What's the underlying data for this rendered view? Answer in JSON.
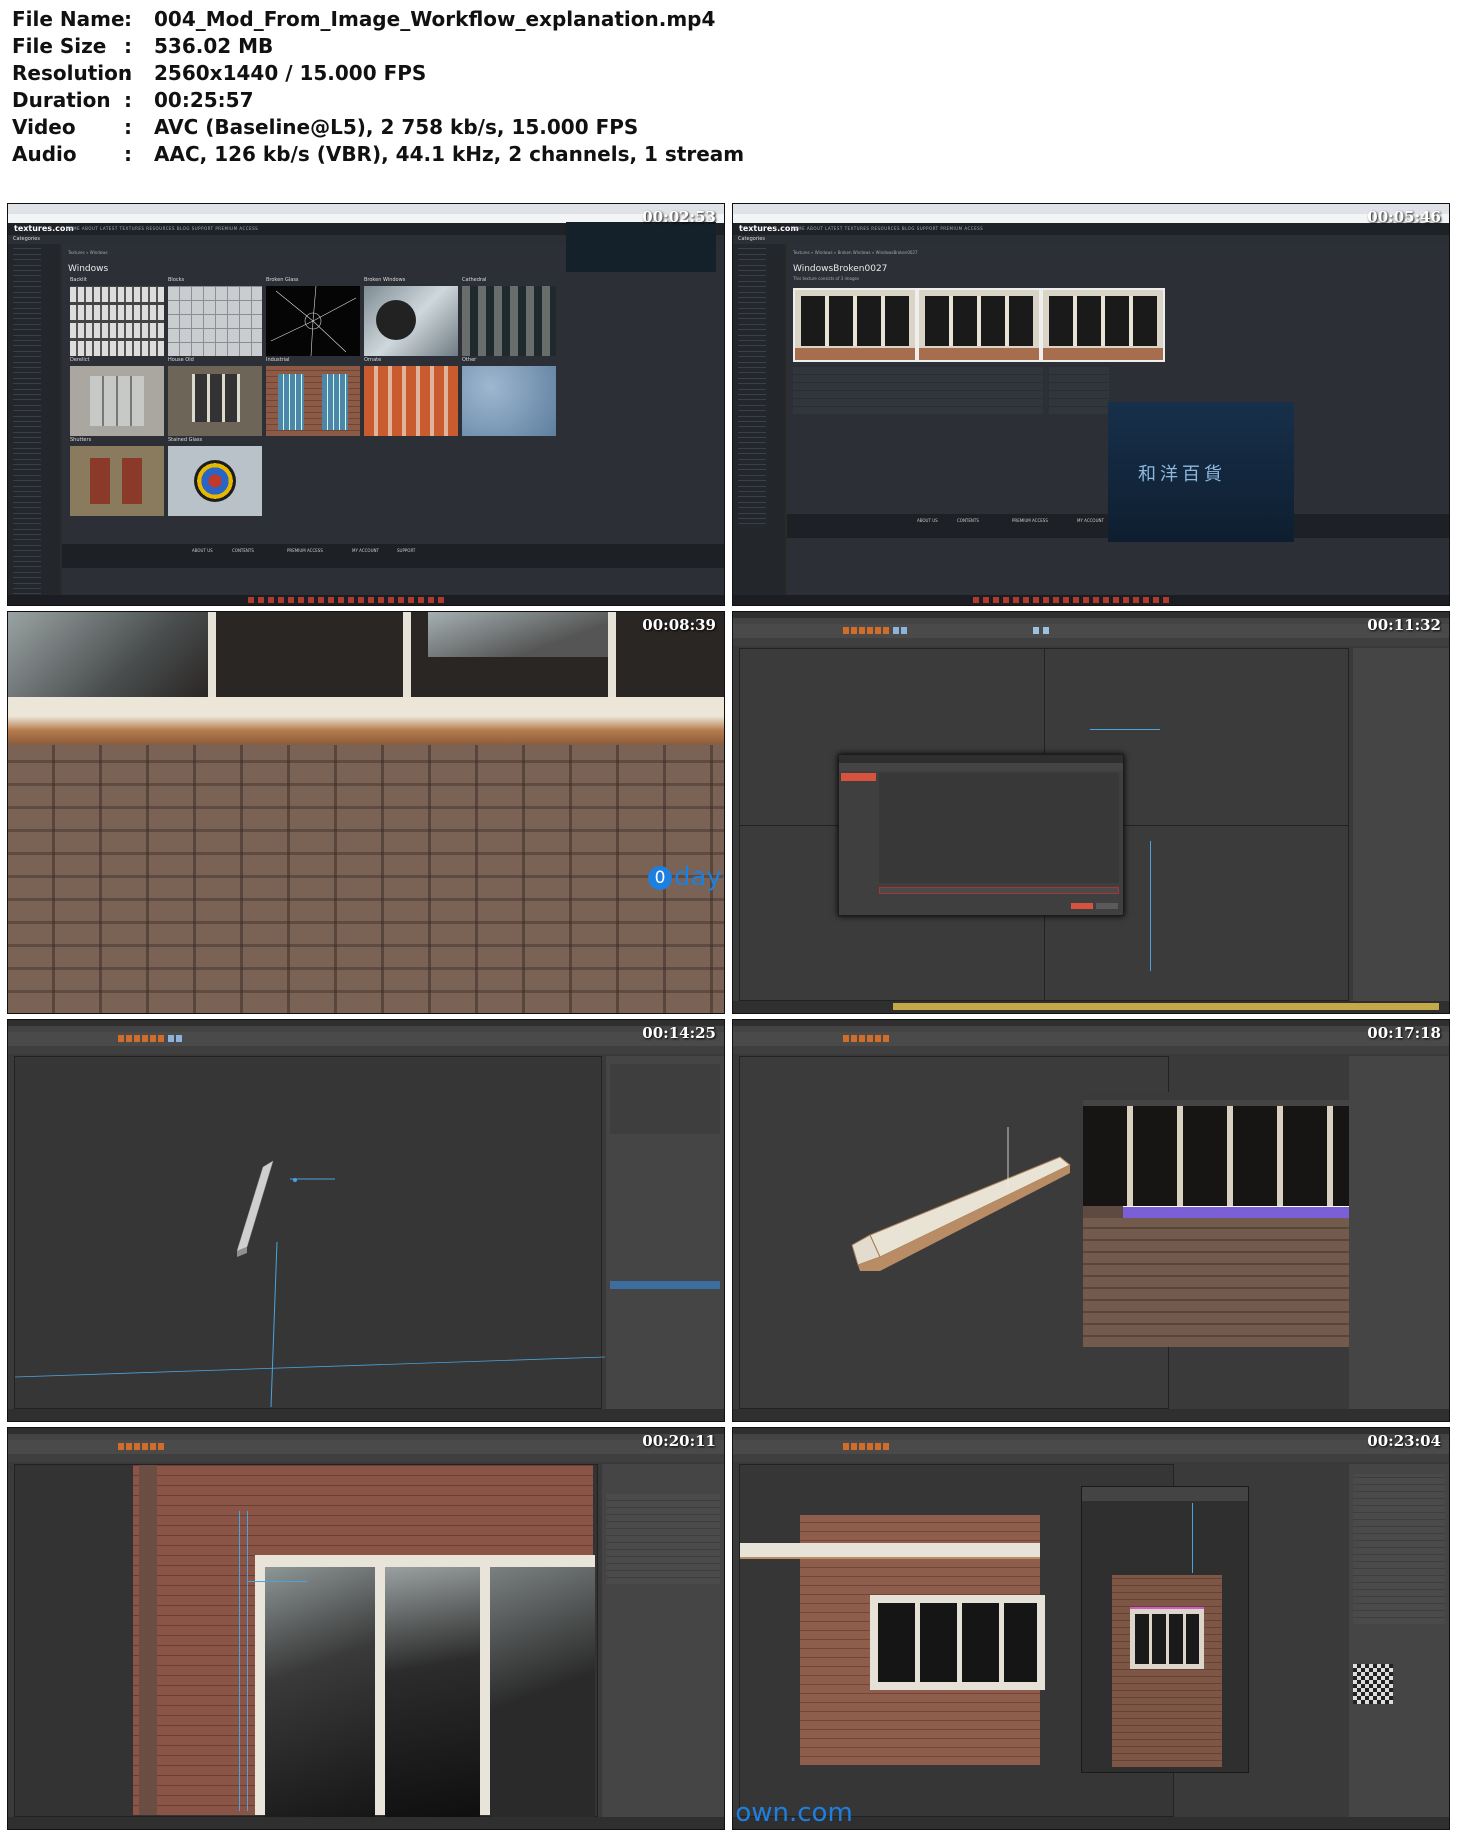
{
  "info": {
    "rows": [
      {
        "label": "File Name",
        "value": "004_Mod_From_Image_Workflow_explanation.mp4"
      },
      {
        "label": "File Size",
        "value": "536.02 MB"
      },
      {
        "label": "Resolution",
        "value": "2560x1440 / 15.000 FPS"
      },
      {
        "label": "Duration",
        "value": "00:25:57"
      },
      {
        "label": "Video",
        "value": "AVC (Baseline@L5), 2 758 kb/s, 15.000 FPS"
      },
      {
        "label": "Audio",
        "value": "AAC, 126 kb/s (VBR), 44.1 kHz, 2 channels, 1 stream"
      }
    ],
    "separator": ":"
  },
  "thumbnails": [
    {
      "timestamp": "00:02:53"
    },
    {
      "timestamp": "00:05:46"
    },
    {
      "timestamp": "00:08:39"
    },
    {
      "timestamp": "00:11:32"
    },
    {
      "timestamp": "00:14:25"
    },
    {
      "timestamp": "00:17:18"
    },
    {
      "timestamp": "00:20:11"
    },
    {
      "timestamp": "00:23:04"
    }
  ],
  "site": {
    "logo": "textures.com",
    "nav": "HOME   ABOUT   LATEST TEXTURES   RESOURCES   BLOG   SUPPORT   PREMIUM ACCESS",
    "categories": "Categories",
    "crumb1": "Textures  »  Windows",
    "title1": "Windows",
    "crumb2": "Textures  »  Windows  »  Broken Windows  »  WindowsBroken0027",
    "title2": "WindowsBroken0027",
    "subtitle2": "This texture consists of 3 images",
    "tiles": [
      "Backlit",
      "Blocks",
      "Broken Glass",
      "Broken Windows",
      "Cathedral",
      "Derelict",
      "House Old",
      "Industrial",
      "Ornate",
      "Other",
      "Shutters",
      "Stained Glass"
    ],
    "footer": [
      "ABOUT US",
      "CONTENTS",
      "PREMIUM ACCESS",
      "MY ACCOUNT",
      "SUPPORT"
    ],
    "sign_text": "和洋百貨"
  },
  "watermark": {
    "text": "daydown.com",
    "badge": "0"
  }
}
